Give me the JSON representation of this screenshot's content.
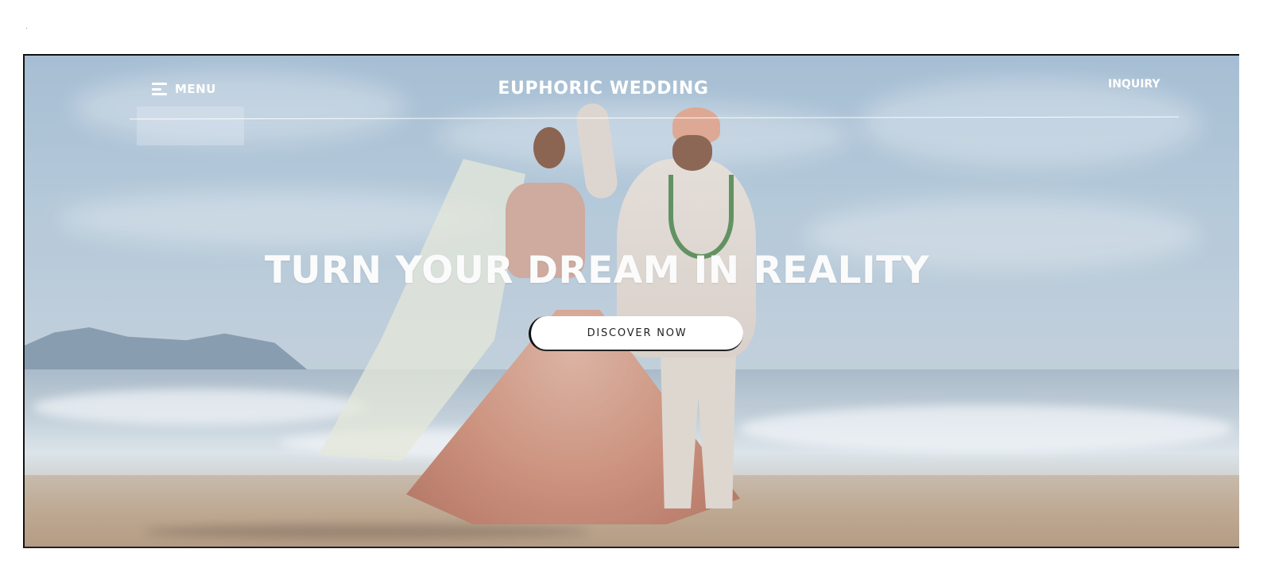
{
  "header": {
    "menu_label": "MENU",
    "brand": "EUPHORIC WEDDING",
    "inquiry_label": "INQUIRY"
  },
  "hero": {
    "headline": "TURN YOUR DREAM IN REALITY",
    "cta_label": "DISCOVER NOW"
  },
  "icons": {
    "menu": "hamburger-icon"
  },
  "colors": {
    "text": "#ffffff",
    "cta_background": "#ffffff",
    "cta_text": "#222222"
  }
}
